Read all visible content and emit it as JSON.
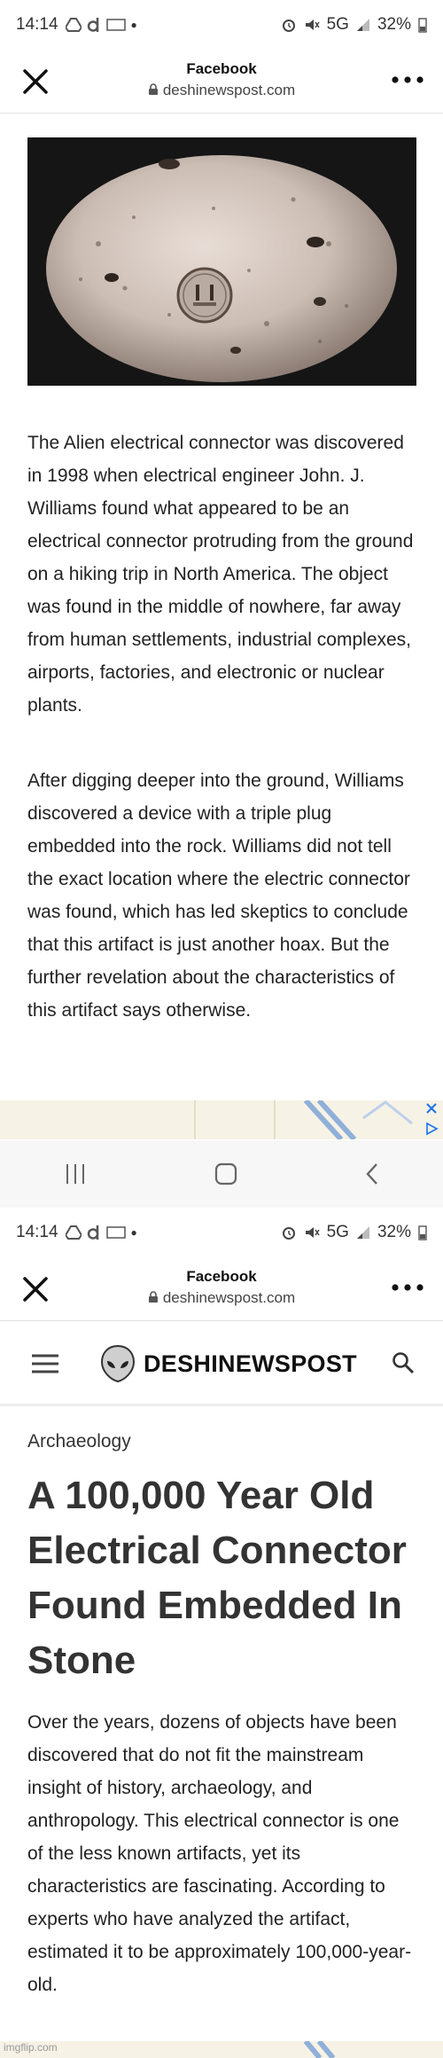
{
  "status_bar_1": {
    "time": "14:14",
    "network": "5G",
    "battery": "32%"
  },
  "browser_1": {
    "title": "Facebook",
    "url": "deshinewspost.com"
  },
  "article_part1": {
    "paragraph_1": "The Alien electrical connector was discovered in 1998 when electrical engineer John. J. Williams found what appeared to be an electrical connector protruding from the ground on a hiking trip in North America. The object was found in the middle of nowhere, far away from human settlements, industrial complexes, airports, factories, and electronic or nuclear plants.",
    "paragraph_2": "After digging deeper into the ground, Williams discovered a device with a triple plug embedded into the rock. Williams did not tell the exact location where the electric connector was found, which has led skeptics to conclude that this artifact is just another hoax. But the further revelation about the characteristics of this artifact says otherwise."
  },
  "status_bar_2": {
    "time": "14:14",
    "network": "5G",
    "battery": "32%"
  },
  "browser_2": {
    "title": "Facebook",
    "url": "deshinewspost.com"
  },
  "site": {
    "logo_text": "DESHINEWSPOST"
  },
  "article_part2": {
    "category": "Archaeology",
    "headline": "A 100,000 Year Old Electrical Connector Found Embedded In Stone",
    "intro": "Over the years, dozens of objects have been discovered that do not fit the mainstream insight of history, archaeology, and anthropology. This electrical connector is one of the less known artifacts, yet its characteristics are fascinating. According to experts who have analyzed the artifact, estimated it to be approximately 100,000-year-old."
  },
  "watermark": "imgflip.com",
  "icons": [
    "close-icon",
    "more-icon",
    "lock-icon",
    "menu-icon",
    "alien-logo-icon",
    "search-icon",
    "recent-apps-icon",
    "home-icon",
    "back-icon",
    "ad-info-icon",
    "ad-close-icon"
  ]
}
